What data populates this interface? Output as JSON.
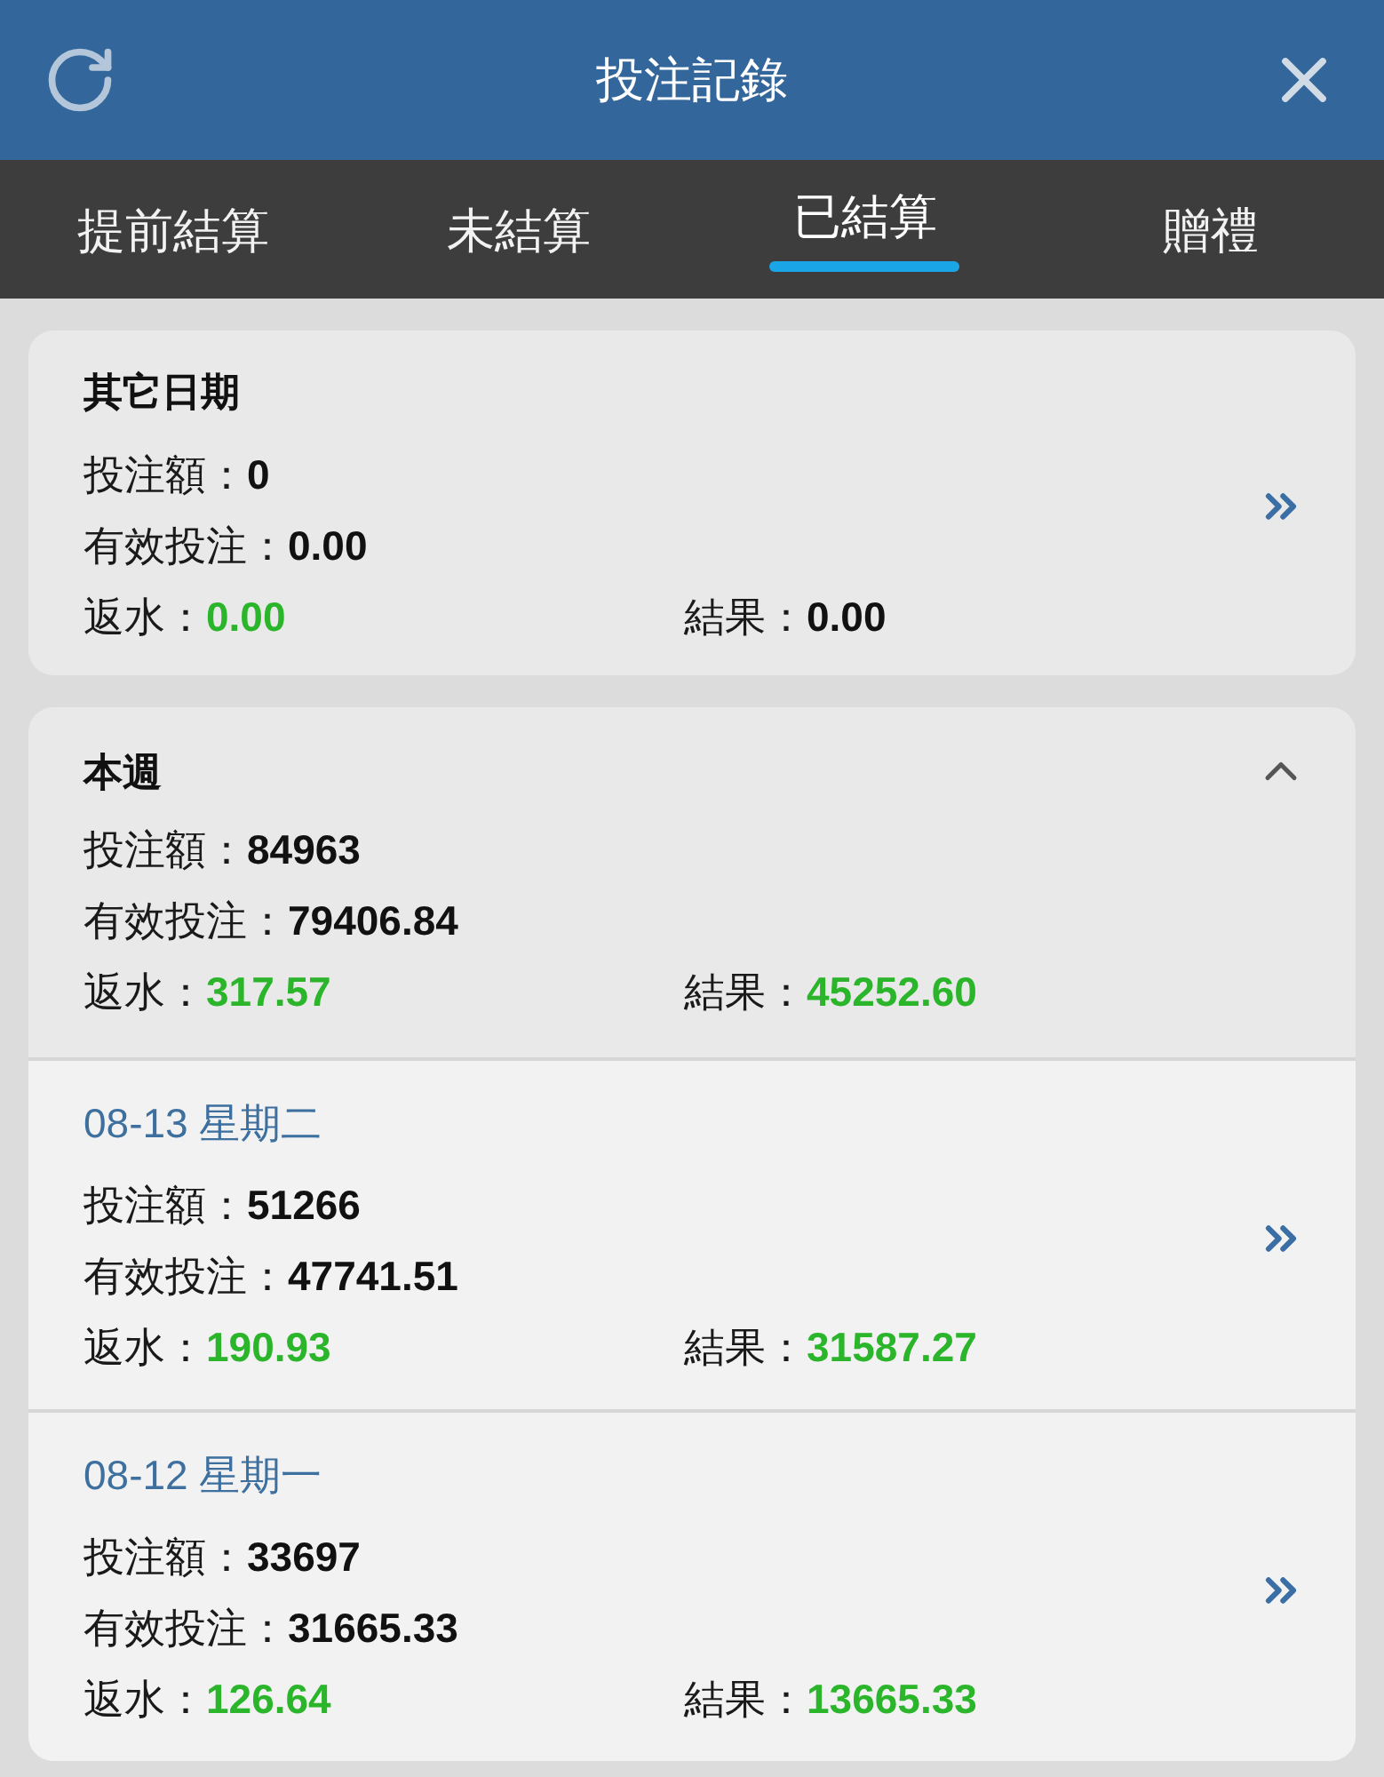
{
  "header": {
    "title": "投注記錄"
  },
  "tabs": [
    {
      "label": "提前結算",
      "selected": false
    },
    {
      "label": "未結算",
      "selected": false
    },
    {
      "label": "已結算",
      "selected": true
    },
    {
      "label": "贈禮",
      "selected": false
    }
  ],
  "sections": [
    {
      "kind": "link",
      "title": "其它日期",
      "rows": [
        [
          {
            "label": "投注額：",
            "value": "0",
            "color": "#111111"
          }
        ],
        [
          {
            "label": "有效投注：",
            "value": "0.00",
            "color": "#111111"
          }
        ],
        [
          {
            "label": "返水：",
            "value": "0.00",
            "color": "#2bb52b"
          },
          {
            "label": "結果：",
            "value": "0.00",
            "color": "#111111"
          }
        ]
      ]
    },
    {
      "kind": "group",
      "title": "本週",
      "expanded": true,
      "rows": [
        [
          {
            "label": "投注額：",
            "value": "84963",
            "color": "#111111"
          }
        ],
        [
          {
            "label": "有效投注：",
            "value": "79406.84",
            "color": "#111111"
          }
        ],
        [
          {
            "label": "返水：",
            "value": "317.57",
            "color": "#2bb52b"
          },
          {
            "label": "結果：",
            "value": "45252.60",
            "color": "#2bb52b"
          }
        ]
      ],
      "days": [
        {
          "date": "08-13 星期二",
          "rows": [
            [
              {
                "label": "投注額：",
                "value": "51266",
                "color": "#111111"
              }
            ],
            [
              {
                "label": "有效投注：",
                "value": "47741.51",
                "color": "#111111"
              }
            ],
            [
              {
                "label": "返水：",
                "value": "190.93",
                "color": "#2bb52b"
              },
              {
                "label": "結果：",
                "value": "31587.27",
                "color": "#2bb52b"
              }
            ]
          ]
        },
        {
          "date": "08-12 星期一",
          "rows": [
            [
              {
                "label": "投注額：",
                "value": "33697",
                "color": "#111111"
              }
            ],
            [
              {
                "label": "有效投注：",
                "value": "31665.33",
                "color": "#111111"
              }
            ],
            [
              {
                "label": "返水：",
                "value": "126.64",
                "color": "#2bb52b"
              },
              {
                "label": "結果：",
                "value": "13665.33",
                "color": "#2bb52b"
              }
            ]
          ]
        }
      ]
    }
  ]
}
